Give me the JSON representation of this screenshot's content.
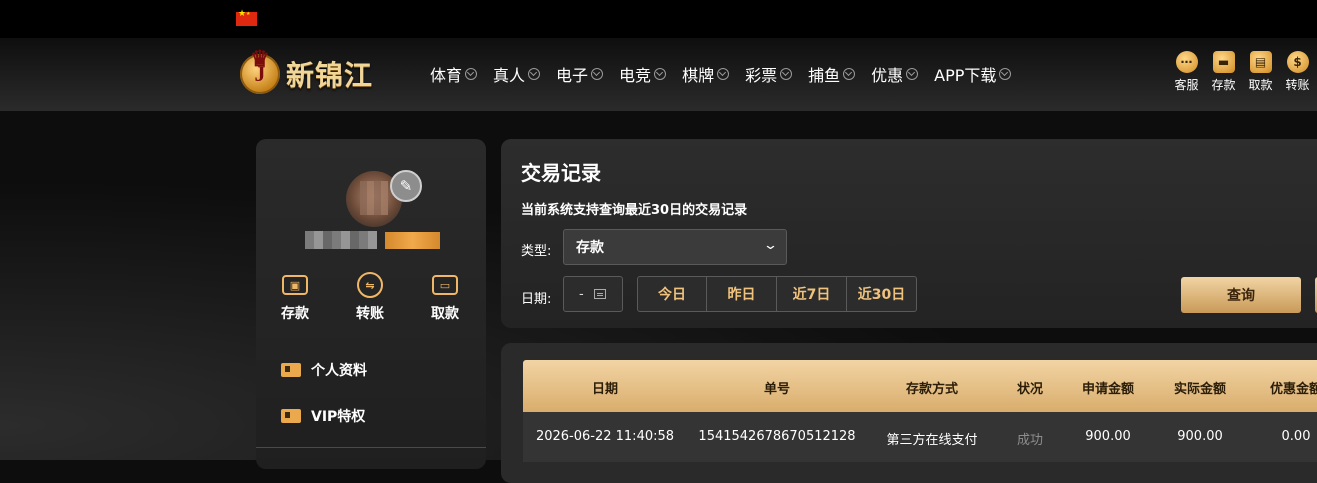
{
  "header": {
    "brand_text": "新锦江",
    "brand_letter": "J",
    "nav": [
      {
        "label": "体育"
      },
      {
        "label": "真人"
      },
      {
        "label": "电子"
      },
      {
        "label": "电竞"
      },
      {
        "label": "棋牌"
      },
      {
        "label": "彩票"
      },
      {
        "label": "捕鱼"
      },
      {
        "label": "优惠"
      },
      {
        "label": "APP下载"
      }
    ],
    "tools": [
      {
        "label": "客服",
        "icon": "chat-icon"
      },
      {
        "label": "存款",
        "icon": "wallet-icon"
      },
      {
        "label": "取款",
        "icon": "cash-icon"
      },
      {
        "label": "转账",
        "icon": "coin-icon"
      }
    ]
  },
  "sidebar": {
    "quick_actions": [
      {
        "label": "存款",
        "icon": "wallet-icon"
      },
      {
        "label": "转账",
        "icon": "transfer-icon"
      },
      {
        "label": "取款",
        "icon": "card-icon"
      }
    ],
    "menu": [
      {
        "label": "个人资料"
      },
      {
        "label": "VIP特权"
      }
    ]
  },
  "records": {
    "title": "交易记录",
    "subtitle": "当前系统支持查询最近30日的交易记录",
    "type_label": "类型:",
    "type_value": "存款",
    "date_label": "日期:",
    "date_value": "-",
    "range_buttons": [
      "今日",
      "昨日",
      "近7日",
      "近30日"
    ],
    "query_label": "查询"
  },
  "table": {
    "columns": [
      "日期",
      "单号",
      "存款方式",
      "状况",
      "申请金额",
      "实际金额",
      "优惠金额"
    ],
    "rows": [
      [
        "2026-06-22 11:40:58",
        "1541542678670512128",
        "第三方在线支付",
        "成功",
        "900.00",
        "900.00",
        "0.00"
      ]
    ]
  },
  "colors": {
    "accent_gold": "#f0c27b",
    "header_gold": "#d9ad6c",
    "status_success": "#8d8d8d"
  }
}
